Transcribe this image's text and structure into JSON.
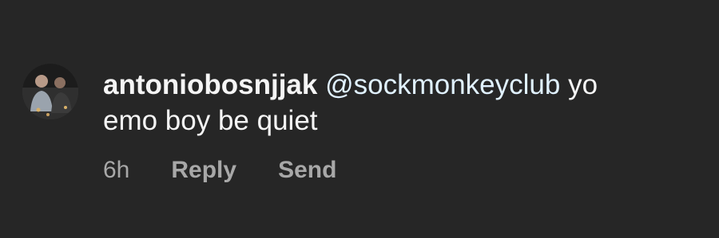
{
  "comment": {
    "avatar_icon": "profile-photo",
    "username": "antoniobosnjjak",
    "mention": "@sockmonkeyclub",
    "text_inline": "yo",
    "text_rest": "emo boy be quiet",
    "timestamp": "6h",
    "reply_label": "Reply",
    "send_label": "Send"
  },
  "colors": {
    "background": "#262626",
    "text": "#f5f5f5",
    "mention": "#e0f1ff",
    "meta": "#a8a8a8"
  }
}
